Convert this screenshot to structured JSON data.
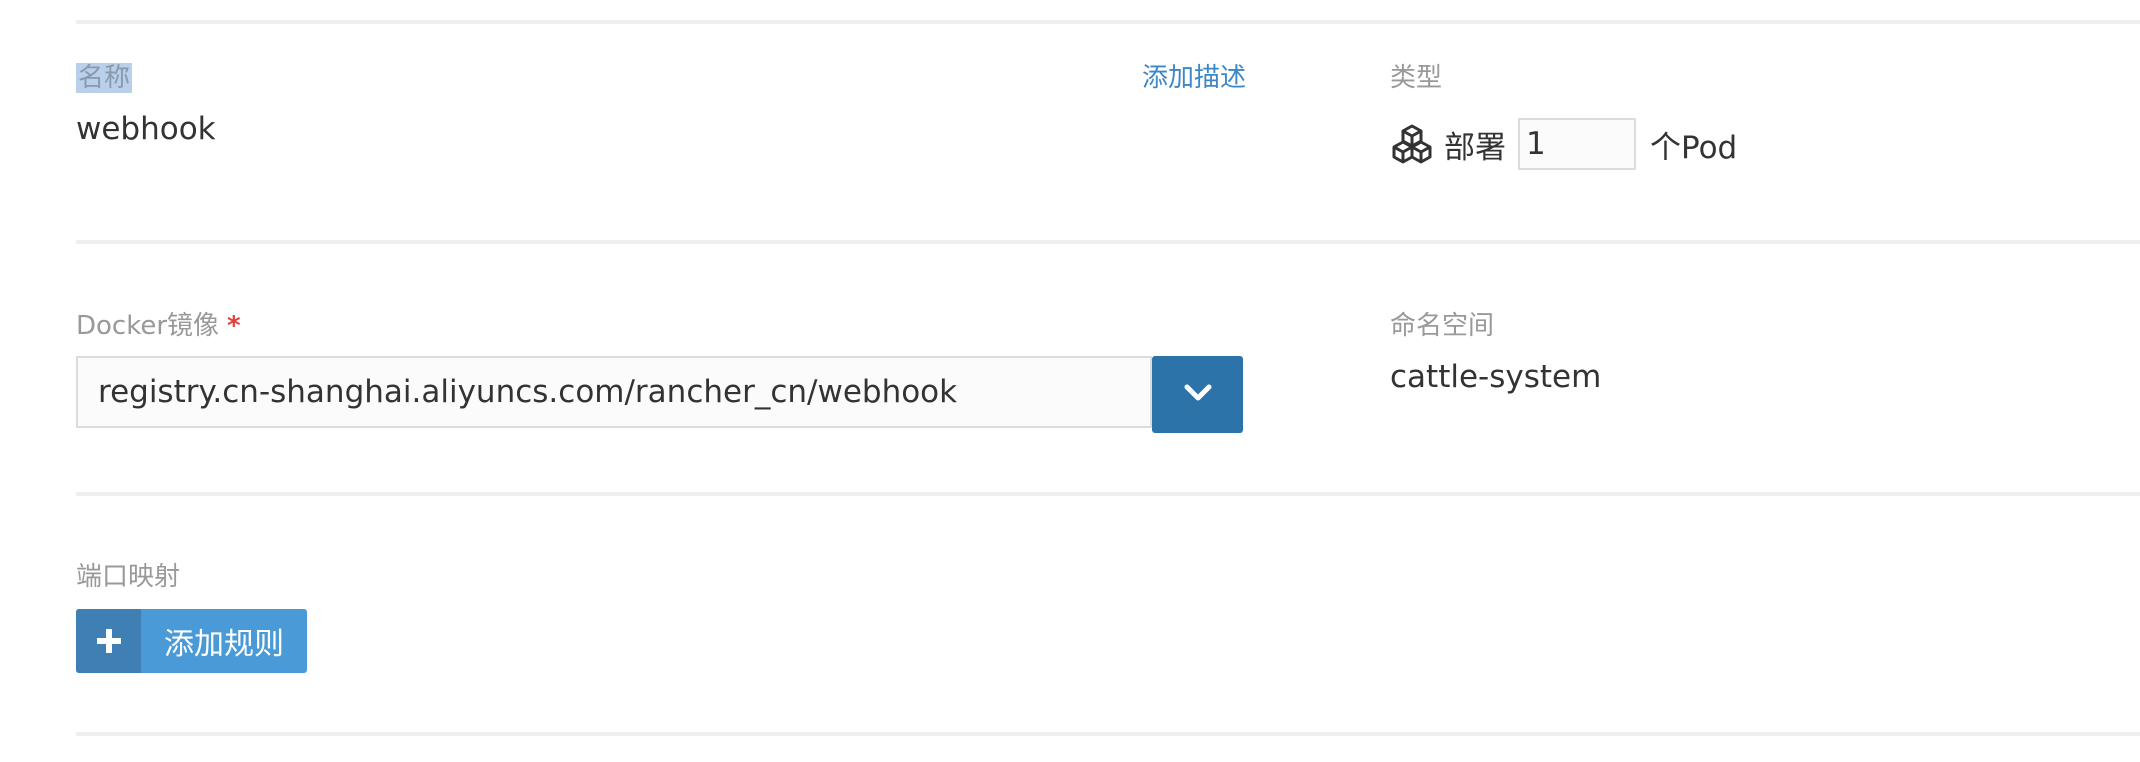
{
  "name_section": {
    "label": "名称",
    "value": "webhook",
    "add_description_link": "添加描述"
  },
  "type_section": {
    "label": "类型",
    "icon": "deployment-cubes-icon",
    "deploy_label": "部署",
    "pod_count": "1",
    "pod_unit": "个Pod"
  },
  "image_section": {
    "label": "Docker镜像",
    "required_mark": "*",
    "image_value": "registry.cn-shanghai.aliyuncs.com/rancher_cn/webhook",
    "dropdown_icon": "chevron-down-icon"
  },
  "namespace_section": {
    "label": "命名空间",
    "value": "cattle-system"
  },
  "port_section": {
    "label": "端口映射",
    "add_rule_icon": "plus-icon",
    "add_rule_label": "添加规则"
  },
  "colors": {
    "primary_button": "#2c73aa",
    "add_button": "#4a9ad8",
    "link": "#3d87c8",
    "required": "#e0403c",
    "selection_highlight": "#b9cfea"
  }
}
